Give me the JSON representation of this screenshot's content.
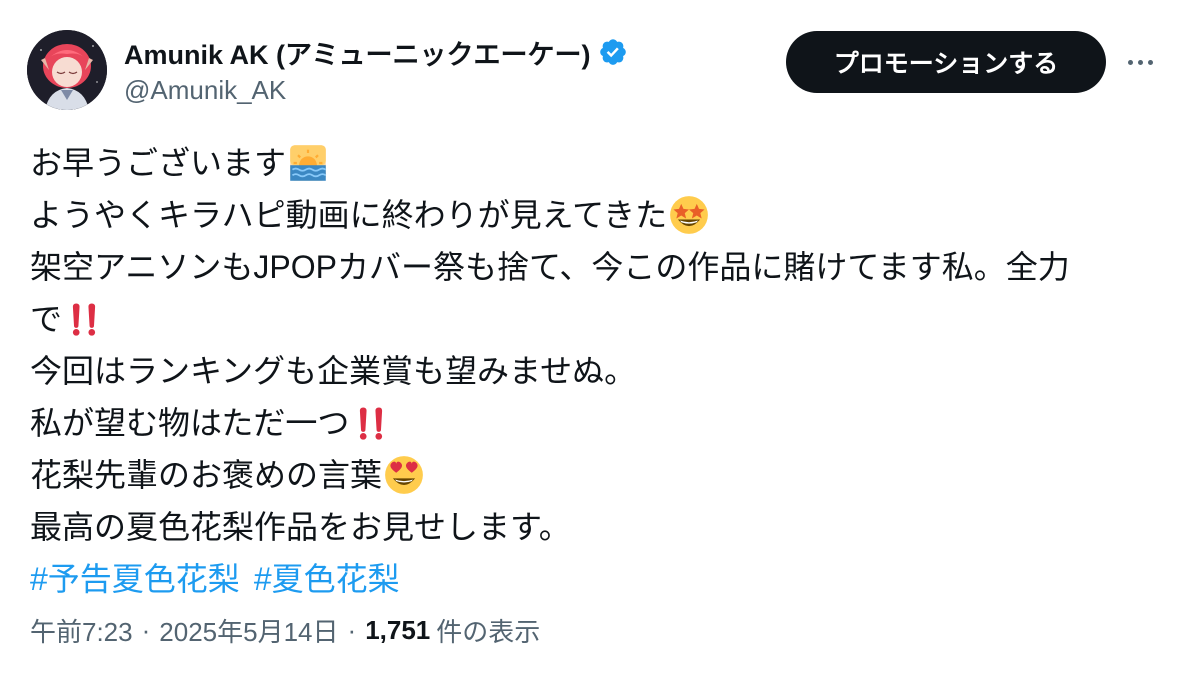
{
  "author": {
    "display_name": "Amunik AK (アミューニックエーケー)",
    "handle": "@Amunik_AK",
    "verified": true,
    "verified_color": "#1d9bf0",
    "avatar": "avatar-pink-hair-character"
  },
  "actions": {
    "promote_label": "プロモーションする",
    "more_icon": "more-horizontal-icon"
  },
  "post": {
    "lines": [
      {
        "text": "お早うございます",
        "emoji": "sunrise-over-sea-emoji"
      },
      {
        "text": "ようやくキラハピ動画に終わりが見えてきた",
        "emoji": "star-struck-emoji"
      },
      {
        "text": "架空アニソンもJPOPカバー祭も捨て、今この作品に賭けてます私。全力"
      },
      {
        "text": "で",
        "emoji": "double-exclamation-emoji"
      },
      {
        "text": "今回はランキングも企業賞も望みませぬ。"
      },
      {
        "text": "私が望む物はただ一つ",
        "emoji": "double-exclamation-emoji"
      },
      {
        "text": "花梨先輩のお褒めの言葉",
        "emoji": "heart-eyes-emoji"
      },
      {
        "text": "最高の夏色花梨作品をお見せします。"
      }
    ],
    "hashtags": [
      "#予告夏色花梨",
      "#夏色花梨"
    ],
    "hashtag_color": "#1d9bf0"
  },
  "meta": {
    "time": "午前7:23",
    "separator": "·",
    "date": "2025年5月14日",
    "views_count": "1,751",
    "views_label": "件の表示"
  },
  "colors": {
    "text_primary": "#0f1419",
    "text_secondary": "#536471",
    "button_bg": "#0f1419"
  }
}
